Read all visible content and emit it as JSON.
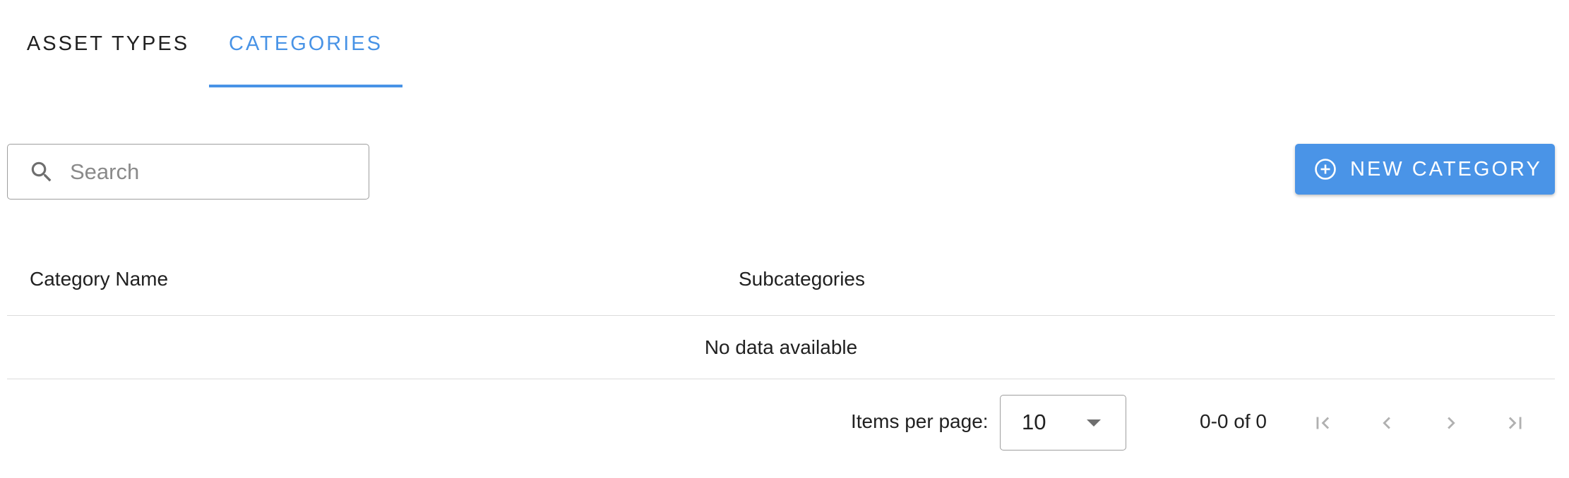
{
  "tabs": [
    {
      "label": "ASSET TYPES",
      "active": false
    },
    {
      "label": "CATEGORIES",
      "active": true
    }
  ],
  "search": {
    "placeholder": "Search",
    "value": "",
    "icon": "search-icon"
  },
  "actions": {
    "new_category_label": "NEW CATEGORY",
    "new_category_icon": "plus-circle-icon"
  },
  "table": {
    "columns": [
      "Category Name",
      "Subcategories"
    ],
    "rows": [],
    "empty_message": "No data available"
  },
  "pagination": {
    "items_per_page_label": "Items per page:",
    "items_per_page_value": "10",
    "range_text": "0-0 of 0",
    "icons": [
      "first-page-icon",
      "previous-page-icon",
      "next-page-icon",
      "last-page-icon"
    ]
  },
  "colors": {
    "accent": "#4893e6",
    "button": "#4a94e7",
    "text": "#212121",
    "divider": "#dcdcdc",
    "disabled_icon": "#b0b0b0"
  }
}
